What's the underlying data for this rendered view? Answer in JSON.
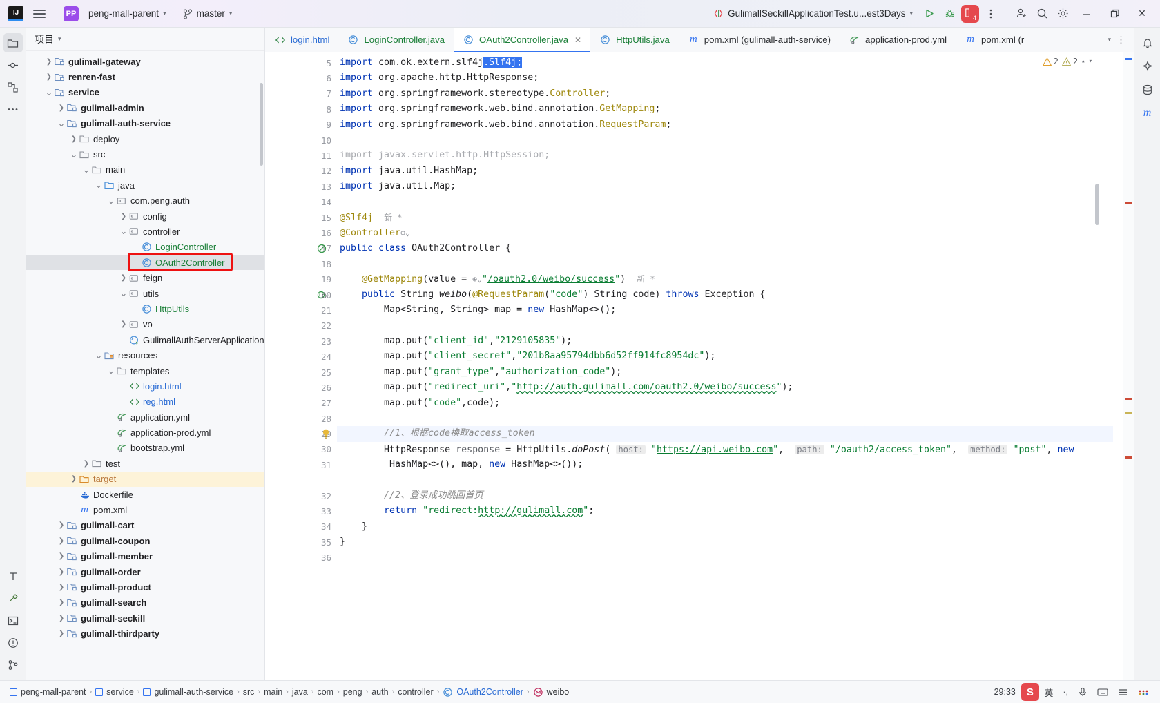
{
  "titlebar": {
    "logo": "IJ",
    "menu_icon": "hamburger-icon",
    "project_badge": "PP",
    "project_name": "peng-mall-parent",
    "branch_icon": "git-branch-icon",
    "branch_name": "master",
    "run_config": "GulimallSeckillApplicationTest.u...est3Days",
    "run_icon": "run-icon",
    "debug_icon": "debug-icon",
    "services_badge": "4",
    "more_icon": "more-vertical-icon",
    "account_icon": "add-user-icon",
    "search_icon": "search-icon",
    "settings_icon": "gear-icon",
    "minimize": "─",
    "maximize": "❐",
    "close": "✕"
  },
  "project_panel": {
    "title": "项目",
    "tree": [
      {
        "label": "gulimall-gateway",
        "depth": 1,
        "arrow": "collapsed",
        "icon": "module-icon",
        "style": "bold"
      },
      {
        "label": "renren-fast",
        "depth": 1,
        "arrow": "collapsed",
        "icon": "module-icon",
        "style": "bold"
      },
      {
        "label": "service",
        "depth": 1,
        "arrow": "expanded",
        "icon": "module-icon",
        "style": "bold"
      },
      {
        "label": "gulimall-admin",
        "depth": 2,
        "arrow": "collapsed",
        "icon": "module-icon",
        "style": "bold"
      },
      {
        "label": "gulimall-auth-service",
        "depth": 2,
        "arrow": "expanded",
        "icon": "module-icon",
        "style": "bold"
      },
      {
        "label": "deploy",
        "depth": 3,
        "arrow": "collapsed",
        "icon": "folder-icon",
        "style": "plain"
      },
      {
        "label": "src",
        "depth": 3,
        "arrow": "expanded",
        "icon": "folder-icon",
        "style": "plain"
      },
      {
        "label": "main",
        "depth": 4,
        "arrow": "expanded",
        "icon": "folder-icon",
        "style": "plain"
      },
      {
        "label": "java",
        "depth": 5,
        "arrow": "expanded",
        "icon": "source-folder-icon",
        "style": "plain"
      },
      {
        "label": "com.peng.auth",
        "depth": 6,
        "arrow": "expanded",
        "icon": "package-icon",
        "style": "plain"
      },
      {
        "label": "config",
        "depth": 7,
        "arrow": "collapsed",
        "icon": "package-icon",
        "style": "plain"
      },
      {
        "label": "controller",
        "depth": 7,
        "arrow": "expanded",
        "icon": "package-icon",
        "style": "plain"
      },
      {
        "label": "LoginController",
        "depth": 8,
        "arrow": "none",
        "icon": "java-class-icon",
        "style": "green"
      },
      {
        "label": "OAuth2Controller",
        "depth": 8,
        "arrow": "none",
        "icon": "java-class-icon",
        "style": "green",
        "state": "selected",
        "annotated": true
      },
      {
        "label": "feign",
        "depth": 7,
        "arrow": "collapsed",
        "icon": "package-icon",
        "style": "plain"
      },
      {
        "label": "utils",
        "depth": 7,
        "arrow": "expanded",
        "icon": "package-icon",
        "style": "plain"
      },
      {
        "label": "HttpUtils",
        "depth": 8,
        "arrow": "none",
        "icon": "java-class-icon",
        "style": "green"
      },
      {
        "label": "vo",
        "depth": 7,
        "arrow": "collapsed",
        "icon": "package-icon",
        "style": "plain"
      },
      {
        "label": "GulimallAuthServerApplication",
        "depth": 7,
        "arrow": "none",
        "icon": "spring-class-icon",
        "style": "plain"
      },
      {
        "label": "resources",
        "depth": 5,
        "arrow": "expanded",
        "icon": "resource-folder-icon",
        "style": "plain"
      },
      {
        "label": "templates",
        "depth": 6,
        "arrow": "expanded",
        "icon": "folder-icon",
        "style": "plain"
      },
      {
        "label": "login.html",
        "depth": 7,
        "arrow": "none",
        "icon": "html-icon",
        "style": "blue"
      },
      {
        "label": "reg.html",
        "depth": 7,
        "arrow": "none",
        "icon": "html-icon",
        "style": "blue"
      },
      {
        "label": "application.yml",
        "depth": 6,
        "arrow": "none",
        "icon": "yaml-icon",
        "style": "plain"
      },
      {
        "label": "application-prod.yml",
        "depth": 6,
        "arrow": "none",
        "icon": "yaml-icon",
        "style": "plain"
      },
      {
        "label": "bootstrap.yml",
        "depth": 6,
        "arrow": "none",
        "icon": "yaml-icon",
        "style": "plain"
      },
      {
        "label": "test",
        "depth": 4,
        "arrow": "collapsed",
        "icon": "folder-icon",
        "style": "plain"
      },
      {
        "label": "target",
        "depth": 3,
        "arrow": "collapsed",
        "icon": "folder-excluded-icon",
        "style": "orange",
        "state": "target-hl"
      },
      {
        "label": "Dockerfile",
        "depth": 3,
        "arrow": "none",
        "icon": "docker-icon",
        "style": "plain"
      },
      {
        "label": "pom.xml",
        "depth": 3,
        "arrow": "none",
        "icon": "maven-icon",
        "style": "plain"
      },
      {
        "label": "gulimall-cart",
        "depth": 2,
        "arrow": "collapsed",
        "icon": "module-icon",
        "style": "bold"
      },
      {
        "label": "gulimall-coupon",
        "depth": 2,
        "arrow": "collapsed",
        "icon": "module-icon",
        "style": "bold"
      },
      {
        "label": "gulimall-member",
        "depth": 2,
        "arrow": "collapsed",
        "icon": "module-icon",
        "style": "bold"
      },
      {
        "label": "gulimall-order",
        "depth": 2,
        "arrow": "collapsed",
        "icon": "module-icon",
        "style": "bold"
      },
      {
        "label": "gulimall-product",
        "depth": 2,
        "arrow": "collapsed",
        "icon": "module-icon",
        "style": "bold"
      },
      {
        "label": "gulimall-search",
        "depth": 2,
        "arrow": "collapsed",
        "icon": "module-icon",
        "style": "bold"
      },
      {
        "label": "gulimall-seckill",
        "depth": 2,
        "arrow": "collapsed",
        "icon": "module-icon",
        "style": "bold"
      },
      {
        "label": "gulimall-thirdparty",
        "depth": 2,
        "arrow": "collapsed",
        "icon": "module-icon",
        "style": "bold"
      }
    ]
  },
  "editor": {
    "tabs": [
      {
        "label": "login.html",
        "icon": "html-icon",
        "active": false,
        "closable": false
      },
      {
        "label": "LoginController.java",
        "icon": "java-class-icon",
        "active": false,
        "closable": false
      },
      {
        "label": "OAuth2Controller.java",
        "icon": "java-class-icon",
        "active": true,
        "closable": true
      },
      {
        "label": "HttpUtils.java",
        "icon": "java-class-icon",
        "active": false,
        "closable": false
      },
      {
        "label": "pom.xml (gulimall-auth-service)",
        "icon": "maven-icon",
        "active": false,
        "closable": false
      },
      {
        "label": "application-prod.yml",
        "icon": "yaml-icon",
        "active": false,
        "closable": false
      },
      {
        "label": "pom.xml (r",
        "icon": "maven-icon",
        "active": false,
        "closable": false
      }
    ],
    "tabs_overflow_icon": "chevron-down-icon",
    "tabs_more_icon": "more-vertical-icon",
    "inspections": {
      "warnings": "2",
      "weak_warnings": "2",
      "up_icon": "chevron-up-icon",
      "down_icon": "chevron-down-icon"
    },
    "first_line": 5,
    "lines": [
      {
        "n": 5,
        "partial": true
      },
      {
        "n": 6
      },
      {
        "n": 7
      },
      {
        "n": 8
      },
      {
        "n": 9
      },
      {
        "n": 10
      },
      {
        "n": 11
      },
      {
        "n": 12
      },
      {
        "n": 13
      },
      {
        "n": 14
      },
      {
        "n": 15
      },
      {
        "n": 16
      },
      {
        "n": 17,
        "gutter_icon": "override-icon"
      },
      {
        "n": 18
      },
      {
        "n": 19
      },
      {
        "n": 20,
        "gutter_icon": "web-mapping-icon"
      },
      {
        "n": 21
      },
      {
        "n": 22
      },
      {
        "n": 23
      },
      {
        "n": 24
      },
      {
        "n": 25
      },
      {
        "n": 26
      },
      {
        "n": 27
      },
      {
        "n": 28
      },
      {
        "n": 29,
        "gutter_icon": "intention-bulb-icon",
        "highlight": true
      },
      {
        "n": 30
      },
      {
        "n": 31
      },
      {
        "n": 32
      },
      {
        "n": 33
      },
      {
        "n": 34
      },
      {
        "n": 35
      },
      {
        "n": 36
      }
    ],
    "code_text": {
      "l5": "import com.ok.extern.slf4j.Slf4j;",
      "l6": "import org.apache.http.HttpResponse;",
      "l7": "import org.springframework.stereotype.Controller;",
      "l8": "import org.springframework.web.bind.annotation.GetMapping;",
      "l9": "import org.springframework.web.bind.annotation.RequestParam;",
      "l11": "import javax.servlet.http.HttpSession;",
      "l12": "import java.util.HashMap;",
      "l13": "import java.util.Map;",
      "l15": "@Slf4j",
      "l15_inlay": "新 *",
      "l16": "@Controller",
      "l17": "public class OAuth2Controller {",
      "l19_a": "@GetMapping(value = ",
      "l19_url": "\"/oauth2.0/weibo/success\"",
      "l19_b": ")",
      "l19_inlay": "新 *",
      "l20": "public String weibo(@RequestParam(\"code\") String code) throws Exception {",
      "l21": "Map<String, String> map = new HashMap<>();",
      "l23": "map.put(\"client_id\",\"2129105835\");",
      "l24": "map.put(\"client_secret\",\"201b8aa95794dbb6d52ff914fc8954dc\");",
      "l25": "map.put(\"grant_type\",\"authorization_code\");",
      "l26": "map.put(\"redirect_uri\",\"http://auth.gulimall.com/oauth2.0/weibo/success\");",
      "l27": "map.put(\"code\",code);",
      "l29": "//1、根据code换取access_token",
      "l30_host_hint": "host:",
      "l30_host": "\"https://api.weibo.com\"",
      "l30_path_hint": "path:",
      "l30_path": "\"/oauth2/access_token\"",
      "l30_method_hint": "method:",
      "l30_method": "\"post\"",
      "l30_cont": "HashMap<>(), map, new HashMap<>());",
      "l32": "//2、登录成功跳回首页",
      "l33_url": "\"redirect:http://gulimall.com\"",
      "l34": "}",
      "l35": "}"
    }
  },
  "left_strip": [
    {
      "name": "project-tool-icon",
      "glyph": "folder"
    },
    {
      "name": "commit-tool-icon",
      "glyph": "commit"
    },
    {
      "name": "structure-tool-icon",
      "glyph": "structure"
    },
    {
      "name": "more-tool-icon",
      "glyph": "dots"
    }
  ],
  "left_strip_bottom": [
    {
      "name": "structure-bottom-icon",
      "glyph": "T"
    },
    {
      "name": "build-tool-icon",
      "glyph": "hammer"
    },
    {
      "name": "terminal-tool-icon",
      "glyph": "terminal"
    },
    {
      "name": "problems-tool-icon",
      "glyph": "warning"
    },
    {
      "name": "git-tool-icon",
      "glyph": "git"
    }
  ],
  "right_strip": [
    {
      "name": "notifications-icon",
      "glyph": "bell"
    },
    {
      "name": "ai-assistant-icon",
      "glyph": "ai"
    },
    {
      "name": "database-icon",
      "glyph": "db"
    },
    {
      "name": "maven-icon",
      "glyph": "m"
    }
  ],
  "statusbar": {
    "breadcrumbs": [
      {
        "label": "peng-mall-parent",
        "icon": "module-icon"
      },
      {
        "label": "service",
        "icon": "module-icon"
      },
      {
        "label": "gulimall-auth-service",
        "icon": "module-icon"
      },
      {
        "label": "src",
        "icon": "none"
      },
      {
        "label": "main",
        "icon": "none"
      },
      {
        "label": "java",
        "icon": "none"
      },
      {
        "label": "com",
        "icon": "none"
      },
      {
        "label": "peng",
        "icon": "none"
      },
      {
        "label": "auth",
        "icon": "none"
      },
      {
        "label": "controller",
        "icon": "none"
      },
      {
        "label": "OAuth2Controller",
        "icon": "java-class-icon"
      },
      {
        "label": "weibo",
        "icon": "method-icon"
      }
    ],
    "caret_position": "29:33",
    "tray": [
      {
        "name": "sogou-ime-icon",
        "label": "S"
      },
      {
        "name": "ime-lang-icon",
        "label": "英"
      },
      {
        "name": "ime-tone-icon",
        "label": "·,"
      },
      {
        "name": "ime-mic-icon",
        "label": "Ἲ4"
      },
      {
        "name": "ime-keyboard-icon",
        "label": "⌨"
      },
      {
        "name": "ime-menu-icon",
        "label": "☰"
      },
      {
        "name": "ime-more-icon",
        "label": "⋯"
      }
    ]
  }
}
